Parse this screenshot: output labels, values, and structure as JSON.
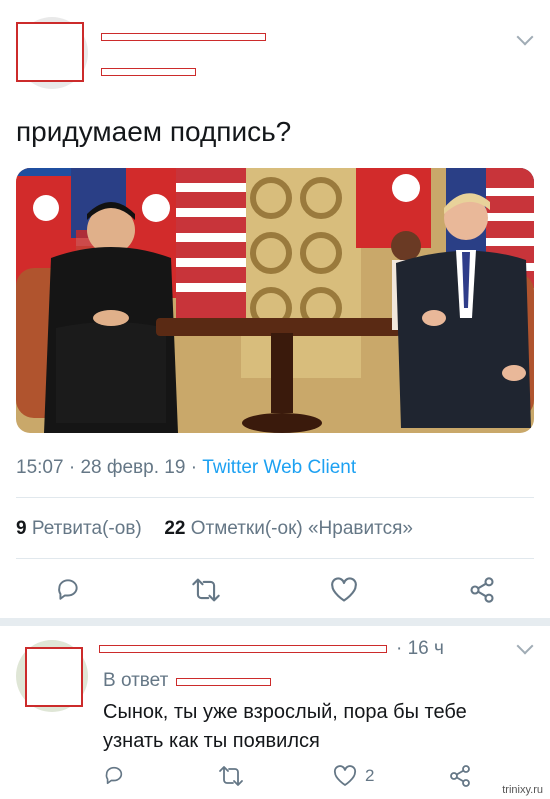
{
  "tweet": {
    "text": "придумаем подпись?",
    "time": "15:07",
    "sep1": "·",
    "date": "28 февр. 19",
    "sep2": "·",
    "client": "Twitter Web Client",
    "retweets_count": "9",
    "retweets_label": "Ретвита(-ов)",
    "likes_count": "22",
    "likes_label": "Отметки(-ок) «Нравится»",
    "icons": {
      "reply": "reply-icon",
      "retweet": "retweet-icon",
      "like": "heart-icon",
      "share": "share-icon",
      "menu": "chevron-down-icon"
    }
  },
  "reply": {
    "time_sep": "·",
    "time": "16 ч",
    "in_reply_label": "В ответ",
    "text_line1": "Сынок, ты уже взрослый, пора бы тебе",
    "text_line2": "узнать как ты появился",
    "like_count": "2"
  },
  "watermark": "trinixy.ru",
  "colors": {
    "link": "#1da1f2",
    "muted": "#657786",
    "redaction": "#cc2b2b",
    "divider": "#e1e8ed"
  }
}
